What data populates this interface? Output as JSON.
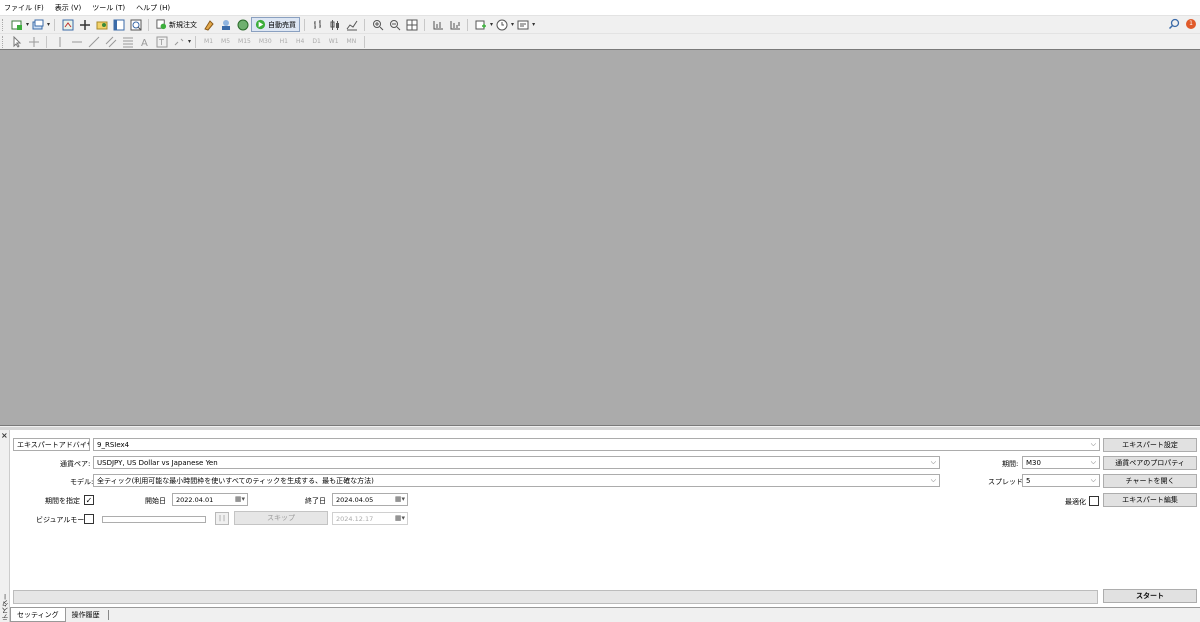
{
  "menu": [
    "ファイル (F)",
    "表示 (V)",
    "ツール (T)",
    "ヘルプ (H)"
  ],
  "toolbar": {
    "new_order": "新規注文",
    "auto_trade": "自動売買",
    "timeframes": [
      "M1",
      "M5",
      "M15",
      "M30",
      "H1",
      "H4",
      "D1",
      "W1",
      "MN"
    ],
    "notification_count": "1"
  },
  "tester": {
    "side_label": "テスター",
    "type_select": "エキスパートアドバイザ",
    "expert_select": "9_RSIex4",
    "symbol_label": "通貨ペア:",
    "symbol_value": "USDJPY, US Dollar vs Japanese Yen",
    "model_label": "モデル:",
    "model_value": "全ティック(利用可能な最小時間枠を使いすべてのティックを生成する、最も正確な方法)",
    "use_date_label": "期間を指定",
    "use_date_checked": "✓",
    "from_label": "開始日",
    "from_value": "2022.04.01",
    "to_label": "終了日",
    "to_value": "2024.04.05",
    "visual_label": "ビジュアルモード",
    "pause_label": "| |",
    "skip_label": "スキップ",
    "skip_date": "2024.12.17",
    "period_label": "期間:",
    "period_value": "M30",
    "spread_label": "スプレッド:",
    "spread_value": "5",
    "optimize_label": "最適化",
    "btn_expert_props": "エキスパート設定",
    "btn_symbol_props": "通貨ペアのプロパティ",
    "btn_open_chart": "チャートを開く",
    "btn_modify_expert": "エキスパート編集",
    "btn_start": "スタート"
  },
  "tabs": [
    "セッティング",
    "操作履歴"
  ]
}
